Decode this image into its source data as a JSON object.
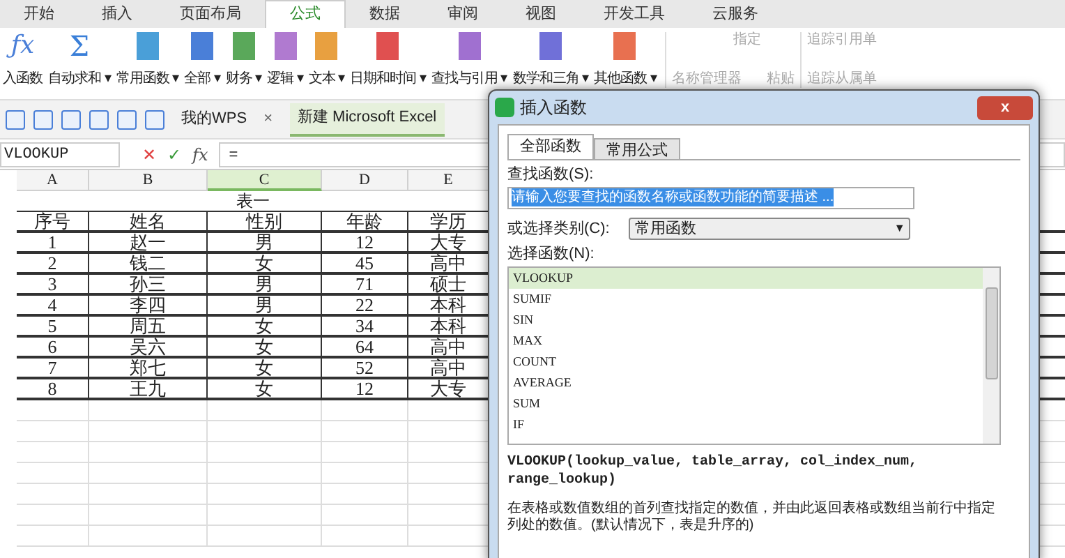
{
  "menu_tabs": [
    {
      "label": "开始",
      "selected": false
    },
    {
      "label": "插入",
      "selected": false
    },
    {
      "label": "页面布局",
      "selected": false
    },
    {
      "label": "公式",
      "selected": true
    },
    {
      "label": "数据",
      "selected": false
    },
    {
      "label": "审阅",
      "selected": false
    },
    {
      "label": "视图",
      "selected": false
    },
    {
      "label": "开发工具",
      "selected": false
    },
    {
      "label": "云服务",
      "selected": false
    }
  ],
  "ribbon": [
    {
      "kind": "fx",
      "glyph": "ƒx",
      "label": "入函数"
    },
    {
      "kind": "sigma",
      "glyph": "Σ",
      "label": "自动求和 ▾"
    },
    {
      "kind": "book",
      "color": "#4a9fd8",
      "label": "常用函数 ▾"
    },
    {
      "kind": "book",
      "color": "#4a7fd8",
      "label": "全部 ▾"
    },
    {
      "kind": "book",
      "color": "#5aa85a",
      "label": "财务 ▾"
    },
    {
      "kind": "book",
      "color": "#b07ad0",
      "label": "逻辑 ▾"
    },
    {
      "kind": "book",
      "color": "#e8a040",
      "label": "文本 ▾"
    },
    {
      "kind": "book",
      "color": "#e05050",
      "label": "日期和时间 ▾"
    },
    {
      "kind": "book",
      "color": "#a070d0",
      "label": "查找与引用 ▾"
    },
    {
      "kind": "book",
      "color": "#7070d8",
      "label": "数学和三角 ▾"
    },
    {
      "kind": "book",
      "color": "#e87050",
      "label": "其他函数 ▾"
    }
  ],
  "ribbon_right": {
    "name_manager": "名称管理器",
    "assign": "指定",
    "paste": "粘贴",
    "trace": "追踪引用单",
    "trace_dependents": "追踪从属单"
  },
  "doc_tabs": [
    {
      "label": "我的WPS",
      "close": "×",
      "selected": false
    },
    {
      "label": "新建 Microsoft Excel",
      "selected": true
    }
  ],
  "formula_bar": {
    "name_box": "VLOOKUP",
    "cancel": "✕",
    "enter": "✓",
    "fx": "fx",
    "value": "="
  },
  "sheet": {
    "columns": [
      {
        "label": "A",
        "selected": false
      },
      {
        "label": "B",
        "selected": false
      },
      {
        "label": "C",
        "selected": true
      },
      {
        "label": "D",
        "selected": false
      },
      {
        "label": "E",
        "selected": false
      }
    ],
    "title": "表一",
    "rows": [
      [
        "序号",
        "姓名",
        "性别",
        "年龄",
        "学历"
      ],
      [
        "1",
        "赵一",
        "男",
        "12",
        "大专"
      ],
      [
        "2",
        "钱二",
        "女",
        "45",
        "高中"
      ],
      [
        "3",
        "孙三",
        "男",
        "71",
        "硕士"
      ],
      [
        "4",
        "李四",
        "男",
        "22",
        "本科"
      ],
      [
        "5",
        "周五",
        "女",
        "34",
        "本科"
      ],
      [
        "6",
        "吴六",
        "女",
        "64",
        "高中"
      ],
      [
        "7",
        "郑七",
        "女",
        "52",
        "高中"
      ],
      [
        "8",
        "王九",
        "女",
        "12",
        "大专"
      ]
    ]
  },
  "dialog": {
    "title": "插入函数",
    "close": "x",
    "tabs": [
      {
        "label": "全部函数",
        "selected": true
      },
      {
        "label": "常用公式",
        "selected": false
      }
    ],
    "search_label": "查找函数(S):",
    "search_value": "请输入您要查找的函数名称或函数功能的简要描述 ...",
    "category_label": "或选择类别(C):",
    "category_value": "常用函数",
    "category_caret": "▼",
    "list_label": "选择函数(N):",
    "functions": [
      {
        "name": "VLOOKUP",
        "selected": true
      },
      {
        "name": "SUMIF",
        "selected": false
      },
      {
        "name": "SIN",
        "selected": false
      },
      {
        "name": "MAX",
        "selected": false
      },
      {
        "name": "COUNT",
        "selected": false
      },
      {
        "name": "AVERAGE",
        "selected": false
      },
      {
        "name": "SUM",
        "selected": false
      },
      {
        "name": "IF",
        "selected": false
      }
    ],
    "signature": "VLOOKUP(lookup_value, table_array, col_index_num, range_lookup)",
    "description": "在表格或数值数组的首列查找指定的数值，并由此返回表格或数组当前行中指定列处的数值。(默认情况下，表是升序的)"
  }
}
